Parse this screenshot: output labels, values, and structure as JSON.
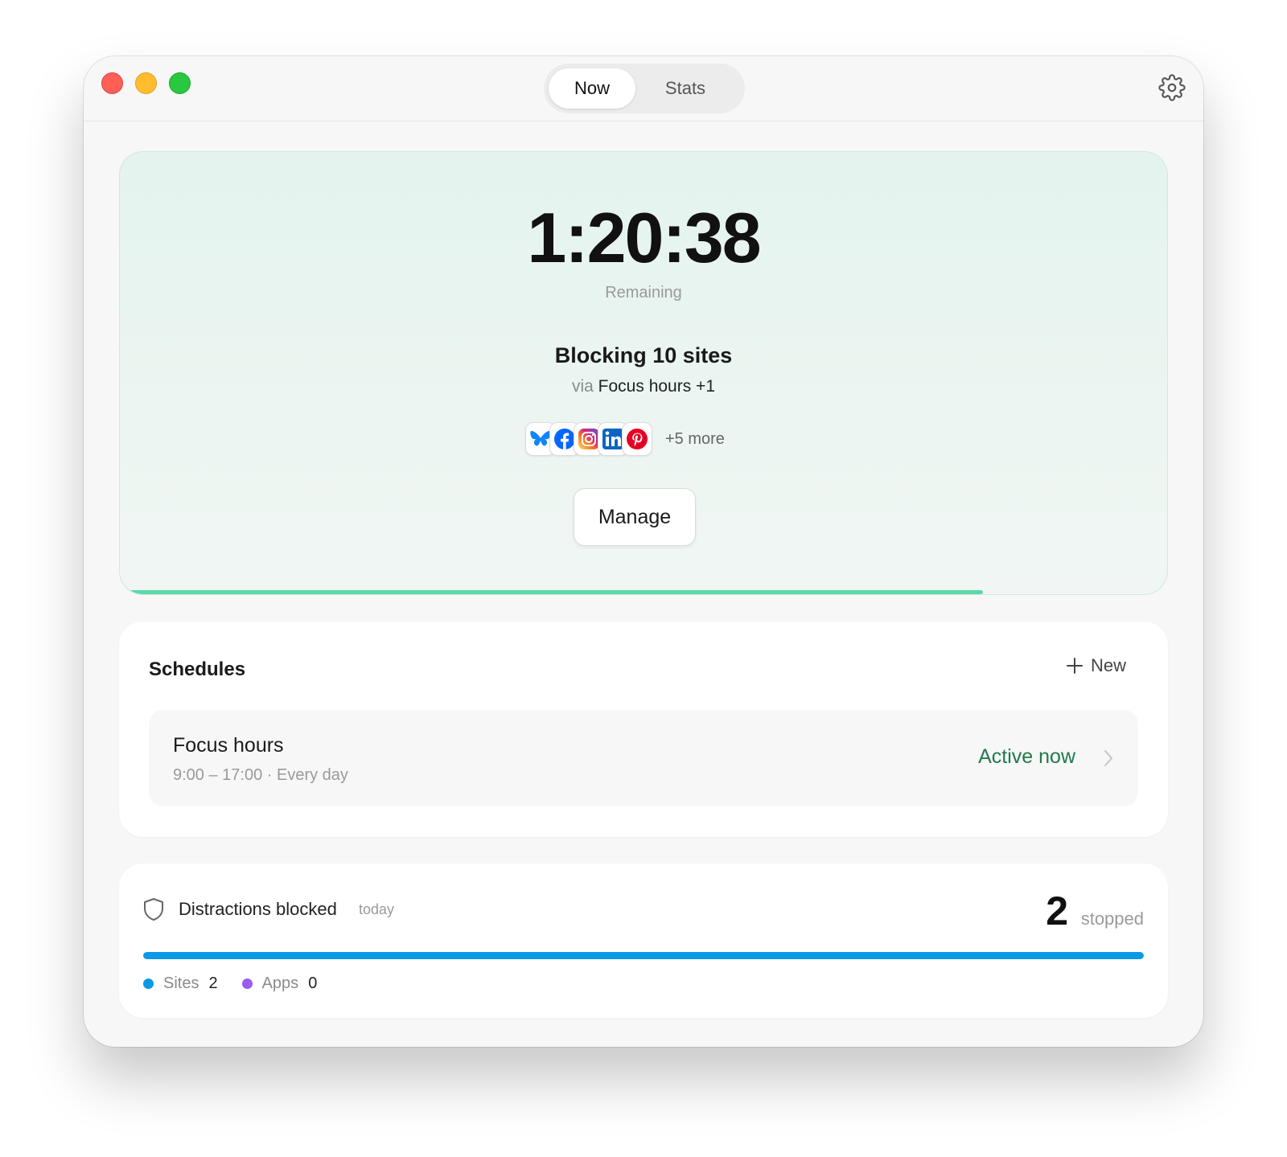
{
  "nav": {
    "tabs": [
      {
        "label": "Now",
        "selected": true
      },
      {
        "label": "Stats",
        "selected": false
      }
    ],
    "settings_icon": "gear-icon"
  },
  "session": {
    "timer": "1:20:38",
    "timer_caption": "Remaining",
    "blocking_title": "Blocking 10 sites",
    "via_prefix": "via",
    "via_source": "Focus hours +1",
    "site_icons": [
      "bluesky-icon",
      "facebook-icon",
      "instagram-icon",
      "linkedin-icon",
      "pinterest-icon"
    ],
    "more_label": "+5 more",
    "manage_label": "Manage",
    "progress": 0.83,
    "accent_color": "#59d9a8"
  },
  "schedules": {
    "title": "Schedules",
    "new_label": "New",
    "items": [
      {
        "name": "Focus hours",
        "time": "9:00 – 17:00 · Every day",
        "status": "Active now",
        "status_color": "#1f7a4b"
      }
    ]
  },
  "distractions": {
    "title": "Distractions blocked",
    "period": "today",
    "count": "2",
    "count_label": "stopped",
    "sites_fraction": 1.0,
    "legend": [
      {
        "label": "Sites",
        "value": "2",
        "color": "#0b99e6"
      },
      {
        "label": "Apps",
        "value": "0",
        "color": "#9b5cf0"
      }
    ]
  }
}
